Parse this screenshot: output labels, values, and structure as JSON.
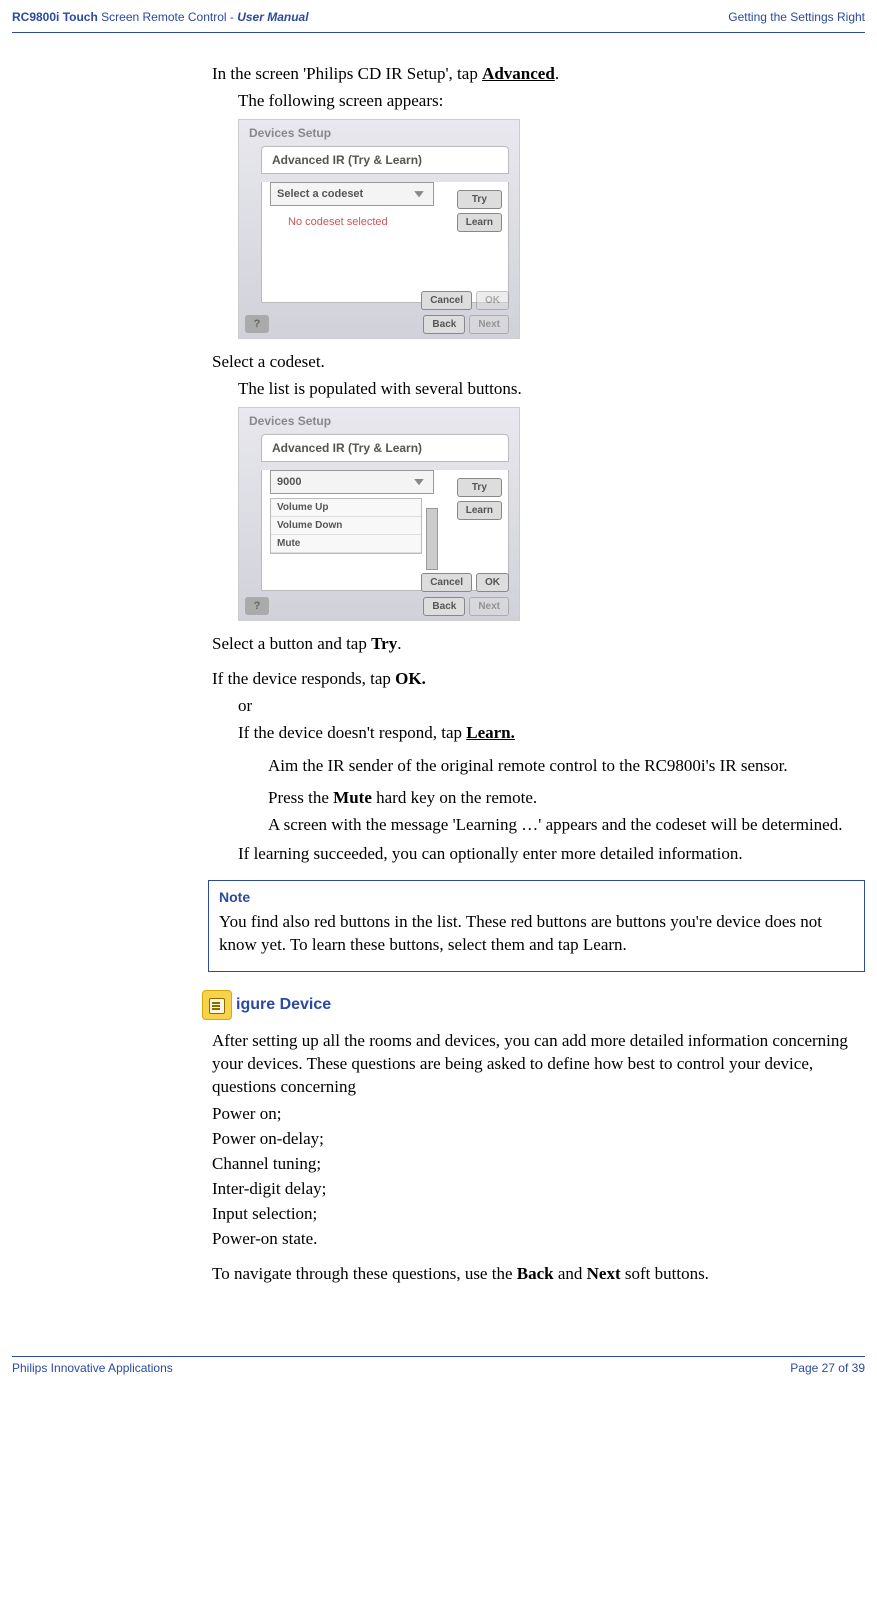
{
  "header": {
    "product": "RC9800i Touch",
    "subtitle_plain": " Screen Remote Control - ",
    "subtitle_em": "User Manual",
    "right": "Getting the Settings Right"
  },
  "intro": {
    "line1_a": "In the screen 'Philips CD IR Setup', tap ",
    "line1_b": "Advanced",
    "line1_c": ".",
    "sub1": "The following screen appears:"
  },
  "screenshot1": {
    "title": "Devices Setup",
    "tab": "Advanced IR (Try & Learn)",
    "select": "Select a codeset",
    "nocode": "No codeset selected",
    "try": "Try",
    "learn": "Learn",
    "cancel": "Cancel",
    "ok": "OK",
    "back": "Back",
    "next": "Next",
    "q": "?"
  },
  "step2": {
    "line": "Select a codeset.",
    "sub": "The list is populated with several buttons."
  },
  "screenshot2": {
    "title": "Devices Setup",
    "tab": "Advanced IR (Try & Learn)",
    "select": "9000",
    "item1": "Volume Up",
    "item2": "Volume Down",
    "item3": "Mute",
    "try": "Try",
    "learn": "Learn",
    "cancel": "Cancel",
    "ok": "OK",
    "back": "Back",
    "next": "Next",
    "q": "?"
  },
  "step3": {
    "line_a": "Select a button and tap ",
    "line_b": "Try",
    "line_c": "."
  },
  "step4": {
    "line_a": "If the device responds, tap ",
    "line_b": "OK.",
    "or": "or",
    "sub_a": "If the device doesn't respond, tap ",
    "sub_b": "Learn.",
    "aim": "Aim the IR sender of the original remote control to the RC9800i's IR sensor.",
    "press_a": "Press the ",
    "press_b": "Mute",
    "press_c": " hard key on the remote.",
    "result": "A screen with the message 'Learning …' appears and the codeset will be determined.",
    "succeed": "If learning succeeded, you can optionally enter more detailed information."
  },
  "note": {
    "title": "Note",
    "body": "You find also red buttons in the list. These red buttons are buttons you're device does not know yet. To learn these buttons, select them and tap Learn."
  },
  "section": {
    "title": "igure Device"
  },
  "config": {
    "para": "After setting up all the rooms and devices, you can add more detailed information concerning your devices. These questions are being asked to define how best to control your device, questions concerning",
    "b1": "Power on;",
    "b2": "Power on-delay;",
    "b3": "Channel tuning;",
    "b4": "Inter-digit delay;",
    "b5": "Input selection;",
    "b6": "Power-on state.",
    "nav_a": "To navigate through these questions, use the ",
    "nav_b": "Back",
    "nav_c": " and ",
    "nav_d": "Next",
    "nav_e": " soft buttons."
  },
  "footer": {
    "left": "Philips Innovative Applications",
    "right": "Page 27 of 39"
  }
}
